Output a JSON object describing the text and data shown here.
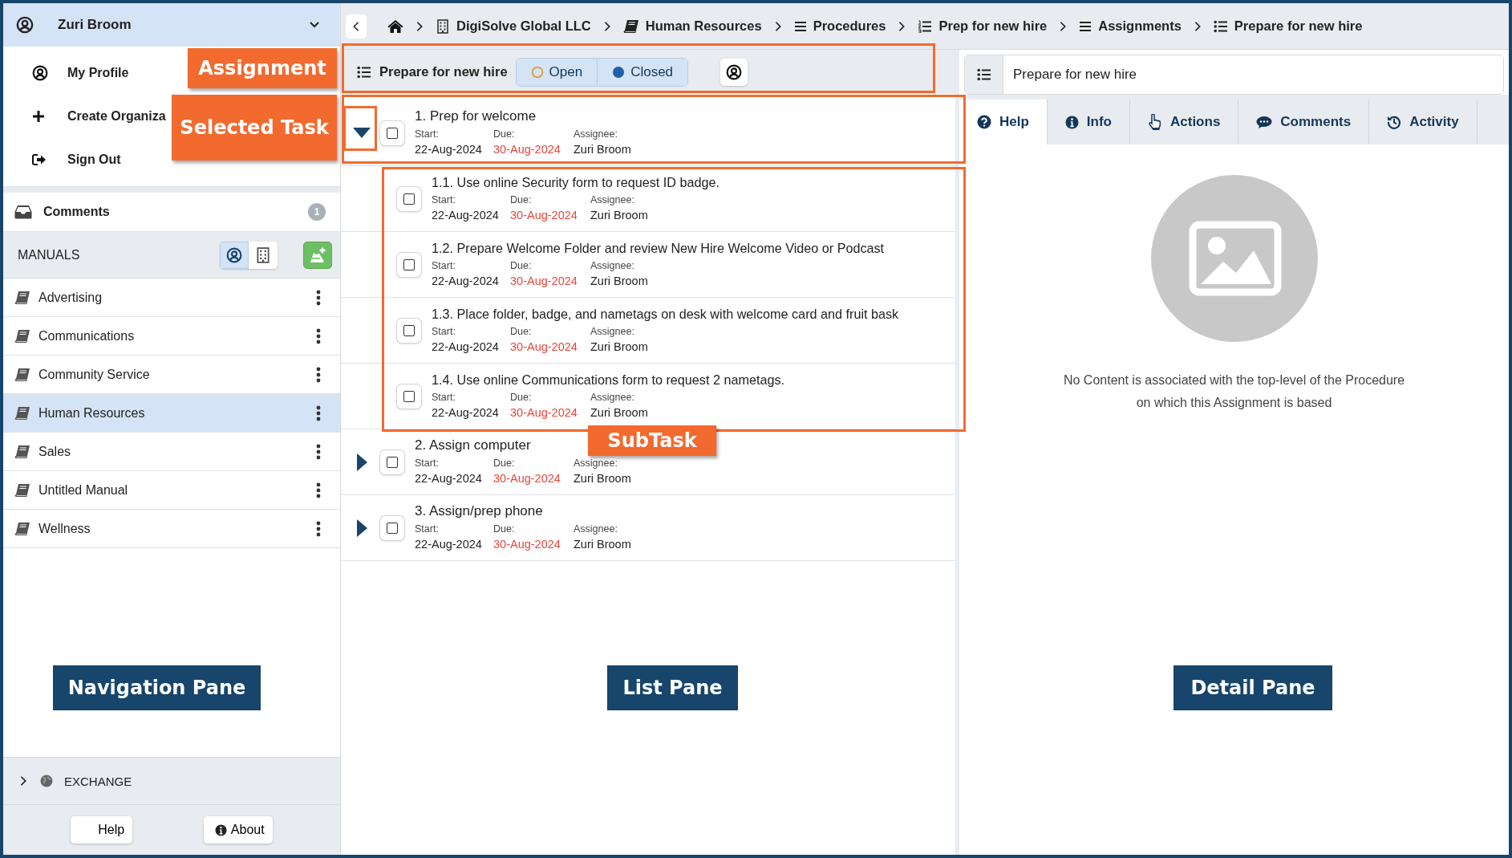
{
  "user_menu": {
    "name": "Zuri Broom",
    "expanded": true,
    "items": [
      {
        "label": "My Profile",
        "kind": "profile"
      },
      {
        "label": "Create Organiza",
        "kind": "create"
      },
      {
        "label": "Sign Out",
        "kind": "signout"
      }
    ]
  },
  "comments": {
    "label": "Comments",
    "count": "1"
  },
  "manuals": {
    "title": "MANUALS",
    "scope": [
      {
        "kind": "personal",
        "selected": true
      },
      {
        "kind": "organization",
        "selected": false
      }
    ],
    "items": [
      {
        "label": "Advertising",
        "selected": false
      },
      {
        "label": "Communications",
        "selected": false
      },
      {
        "label": "Community Service",
        "selected": false
      },
      {
        "label": "Human Resources",
        "selected": true
      },
      {
        "label": "Sales",
        "selected": false
      },
      {
        "label": "Untitled Manual",
        "selected": false
      },
      {
        "label": "Wellness",
        "selected": false
      }
    ]
  },
  "exchange": {
    "label": "EXCHANGE",
    "expanded": false
  },
  "footer_buttons": [
    {
      "label": "Help",
      "kind": "help"
    },
    {
      "label": "About",
      "kind": "about"
    }
  ],
  "breadcrumb": [
    {
      "label": "DigiSolve Global LLC",
      "kind": "organization"
    },
    {
      "label": "Human Resources",
      "kind": "manual"
    },
    {
      "label": "Procedures",
      "kind": "lines"
    },
    {
      "label": "Prep for new hire",
      "kind": "numbered"
    },
    {
      "label": "Assignments",
      "kind": "lines"
    },
    {
      "label": "Prepare for new hire",
      "kind": "bulleted"
    }
  ],
  "assignment": {
    "title": "Prepare for new hire",
    "filters": [
      {
        "label": "Open",
        "kind": "open"
      },
      {
        "label": "Closed",
        "kind": "closed"
      }
    ]
  },
  "tasks": [
    {
      "title": "1. Prep for welcome",
      "expanded": true,
      "checked": false,
      "start_label": "Start:",
      "due_label": "Due:",
      "assignee_label": "Assignee:",
      "start": "22-Aug-2024",
      "due": "30-Aug-2024",
      "overdue": true,
      "assignee": "Zuri Broom",
      "children": [
        {
          "title": "1.1. Use online Security form to request ID badge.",
          "checked": false,
          "start_label": "Start:",
          "due_label": "Due:",
          "assignee_label": "Assignee:",
          "start": "22-Aug-2024",
          "due": "30-Aug-2024",
          "overdue": true,
          "assignee": "Zuri Broom"
        },
        {
          "title": "1.2. Prepare Welcome Folder and review New Hire Welcome Video or Podcast",
          "checked": false,
          "start_label": "Start:",
          "due_label": "Due:",
          "assignee_label": "Assignee:",
          "start": "22-Aug-2024",
          "due": "30-Aug-2024",
          "overdue": true,
          "assignee": "Zuri Broom"
        },
        {
          "title": "1.3. Place folder, badge, and nametags on desk with welcome card and fruit bask",
          "checked": false,
          "start_label": "Start:",
          "due_label": "Due:",
          "assignee_label": "Assignee:",
          "start": "22-Aug-2024",
          "due": "30-Aug-2024",
          "overdue": true,
          "assignee": "Zuri Broom"
        },
        {
          "title": "1.4. Use online Communications form to request 2 nametags.",
          "checked": false,
          "start_label": "Start:",
          "due_label": "Due:",
          "assignee_label": "Assignee:",
          "start": "22-Aug-2024",
          "due": "30-Aug-2024",
          "overdue": true,
          "assignee": "Zuri Broom"
        }
      ]
    },
    {
      "title": "2. Assign computer",
      "expanded": false,
      "checked": false,
      "start_label": "Start:",
      "due_label": "Due:",
      "assignee_label": "Assignee:",
      "start": "22-Aug-2024",
      "due": "30-Aug-2024",
      "overdue": true,
      "assignee": "Zuri Broom"
    },
    {
      "title": "3. Assign/prep phone",
      "expanded": false,
      "checked": false,
      "start_label": "Start:",
      "due_label": "Due:",
      "assignee_label": "Assignee:",
      "start": "22-Aug-2024",
      "due": "30-Aug-2024",
      "overdue": true,
      "assignee": "Zuri Broom"
    }
  ],
  "detail": {
    "title": "Prepare for new hire",
    "tabs": [
      {
        "label": "Help",
        "kind": "help",
        "selected": true
      },
      {
        "label": "Info",
        "kind": "info",
        "selected": false
      },
      {
        "label": "Actions",
        "kind": "actions",
        "selected": false
      },
      {
        "label": "Comments",
        "kind": "comments",
        "selected": false
      },
      {
        "label": "Activity",
        "kind": "activity",
        "selected": false
      }
    ],
    "message": "No Content is associated with the top-level of the Procedure on which this Assignment is based"
  },
  "callouts": [
    {
      "label": "Assignment",
      "kind": "highlight"
    },
    {
      "label": "Selected Task",
      "kind": "highlight"
    },
    {
      "label": "SubTask",
      "kind": "highlight"
    },
    {
      "label": "Navigation Pane",
      "kind": "pane"
    },
    {
      "label": "List Pane",
      "kind": "pane"
    },
    {
      "label": "Detail Pane",
      "kind": "pane"
    }
  ]
}
